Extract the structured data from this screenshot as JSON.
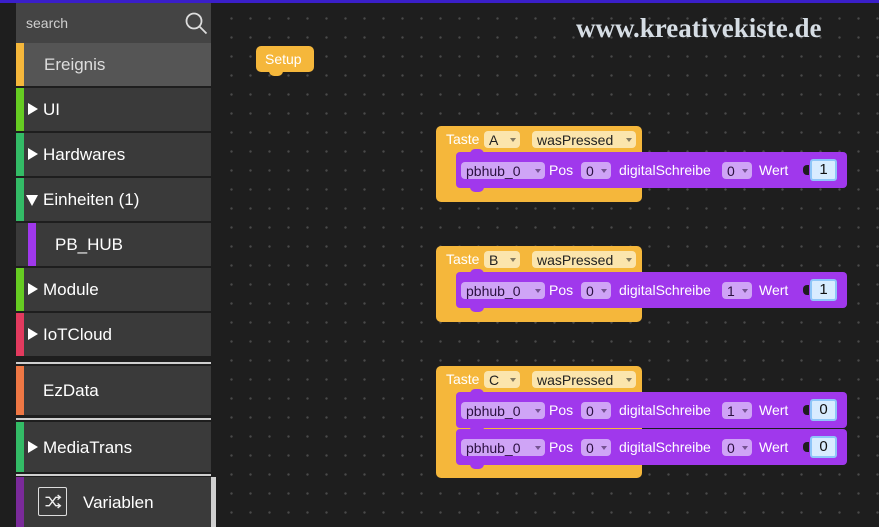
{
  "search": {
    "placeholder": "search"
  },
  "sidebar": {
    "categories": [
      {
        "label": "Ereignis",
        "color": "#f5b73b",
        "expandable": false,
        "selected": true
      },
      {
        "label": "UI",
        "color": "#66cc22",
        "expandable": true,
        "expanded": false
      },
      {
        "label": "Hardwares",
        "color": "#33bb66",
        "expandable": true,
        "expanded": false
      },
      {
        "label": "Einheiten (1)",
        "color": "#33bb66",
        "expandable": true,
        "expanded": true
      },
      {
        "label": "PB_HUB",
        "color": "#a038ec",
        "expandable": false
      },
      {
        "label": "Module",
        "color": "#66cc22",
        "expandable": true,
        "expanded": false
      },
      {
        "label": "IoTCloud",
        "color": "#e23a5e",
        "expandable": true,
        "expanded": false
      },
      {
        "label": "EzData",
        "color": "#ee7744",
        "expandable": false
      },
      {
        "label": "MediaTrans",
        "color": "#33bb66",
        "expandable": true,
        "expanded": false
      },
      {
        "label": "Variablen",
        "color": "#7a2a9a",
        "expandable": false,
        "icon": "shuffle-icon"
      }
    ]
  },
  "workspace": {
    "watermark": "www.kreativekiste.de",
    "setup_block": "Setup",
    "event_blocks": [
      {
        "label": "Taste",
        "button": "A",
        "event": "wasPressed",
        "statements": [
          {
            "device": "pbhub_0",
            "pos_label": "Pos",
            "pos": "0",
            "action": "digitalSchreibe",
            "pin": "0",
            "value_label": "Wert",
            "value": "1"
          }
        ]
      },
      {
        "label": "Taste",
        "button": "B",
        "event": "wasPressed",
        "statements": [
          {
            "device": "pbhub_0",
            "pos_label": "Pos",
            "pos": "0",
            "action": "digitalSchreibe",
            "pin": "1",
            "value_label": "Wert",
            "value": "1"
          }
        ]
      },
      {
        "label": "Taste",
        "button": "C",
        "event": "wasPressed",
        "statements": [
          {
            "device": "pbhub_0",
            "pos_label": "Pos",
            "pos": "0",
            "action": "digitalSchreibe",
            "pin": "1",
            "value_label": "Wert",
            "value": "0"
          },
          {
            "device": "pbhub_0",
            "pos_label": "Pos",
            "pos": "0",
            "action": "digitalSchreibe",
            "pin": "0",
            "value_label": "Wert",
            "value": "0"
          }
        ]
      }
    ]
  },
  "colors": {
    "event_block": "#f5b73b",
    "pbhub_block": "#a038ec",
    "accent_bar": "#3a1fc9"
  }
}
